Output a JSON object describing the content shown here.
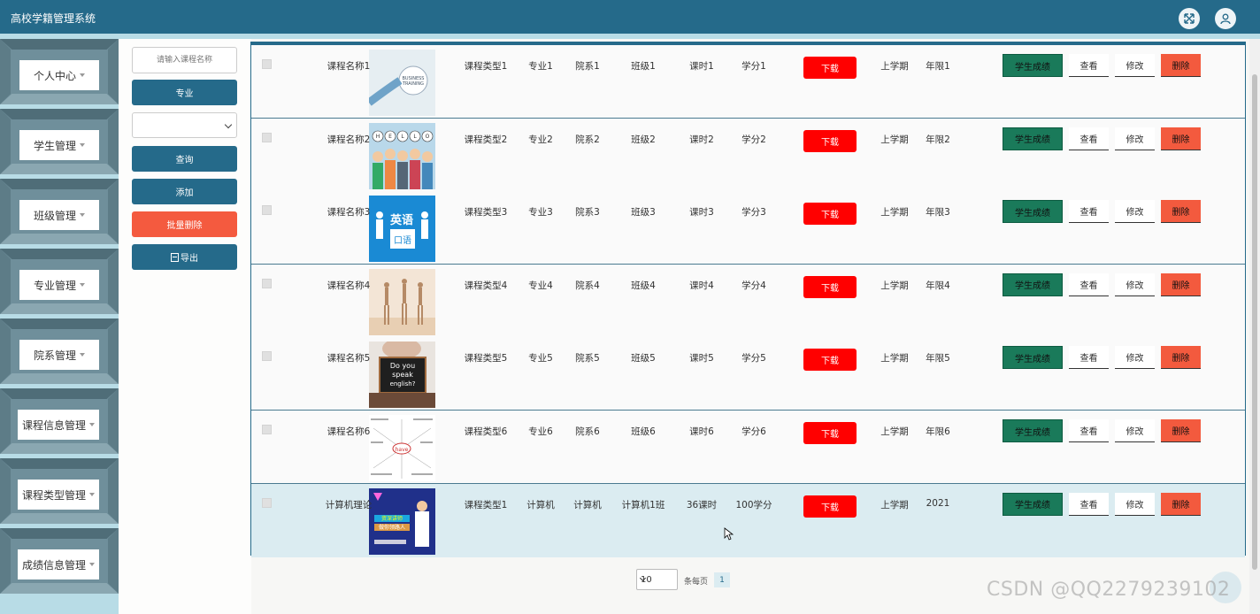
{
  "app": {
    "title": "高校学籍管理系统"
  },
  "header": {
    "fullscreen_icon": "fullscreen-icon",
    "user_icon": "user-icon"
  },
  "sidebar": {
    "items": [
      {
        "label": "个人中心"
      },
      {
        "label": "学生管理"
      },
      {
        "label": "班级管理"
      },
      {
        "label": "专业管理"
      },
      {
        "label": "院系管理"
      },
      {
        "label": "课程信息管理"
      },
      {
        "label": "课程类型管理"
      },
      {
        "label": "成绩信息管理"
      }
    ]
  },
  "search": {
    "placeholder": "请输入课程名称",
    "major_label": "专业",
    "select_value": "",
    "query_label": "查询",
    "add_label": "添加",
    "batch_delete_label": "批量删除",
    "export_label": "导出"
  },
  "table": {
    "download_label": "下载",
    "grade_label": "学生成绩",
    "view_label": "查看",
    "edit_label": "修改",
    "delete_label": "删除",
    "rows": [
      {
        "name": "课程名称1",
        "type": "课程类型1",
        "major": "专业1",
        "dept": "院系1",
        "class": "班级1",
        "hours": "课时1",
        "credit": "学分1",
        "term": "上学期",
        "year": "年限1",
        "image": "business-training"
      },
      {
        "name": "课程名称2",
        "type": "课程类型2",
        "major": "专业2",
        "dept": "院系2",
        "class": "班级2",
        "hours": "课时2",
        "credit": "学分2",
        "term": "上学期",
        "year": "年限2",
        "image": "hello-people"
      },
      {
        "name": "课程名称3",
        "type": "课程类型3",
        "major": "专业3",
        "dept": "院系3",
        "class": "班级3",
        "hours": "课时3",
        "credit": "学分3",
        "term": "上学期",
        "year": "年限3",
        "image": "english-speaking"
      },
      {
        "name": "课程名称4",
        "type": "课程类型4",
        "major": "专业4",
        "dept": "院系4",
        "class": "班级4",
        "hours": "课时4",
        "credit": "学分4",
        "term": "上学期",
        "year": "年限4",
        "image": "dancers"
      },
      {
        "name": "课程名称5",
        "type": "课程类型5",
        "major": "专业5",
        "dept": "院系5",
        "class": "班级5",
        "hours": "课时5",
        "credit": "学分5",
        "term": "上学期",
        "year": "年限5",
        "image": "do-you-speak-english"
      },
      {
        "name": "课程名称6",
        "type": "课程类型6",
        "major": "专业6",
        "dept": "院系6",
        "class": "班级6",
        "hours": "课时6",
        "credit": "学分6",
        "term": "上学期",
        "year": "年限6",
        "image": "have-wordcloud"
      },
      {
        "name": "计算机理论",
        "type": "课程类型1",
        "major": "计算机",
        "dept": "计算机",
        "class": "计算机1班",
        "hours": "36课时",
        "credit": "100学分",
        "term": "上学期",
        "year": "2021",
        "image": "lecturer-poster"
      }
    ]
  },
  "pager": {
    "page_size": "10",
    "per_page_label": "条每页",
    "current_page": "1"
  },
  "watermark": "CSDN @QQ2279239102"
}
